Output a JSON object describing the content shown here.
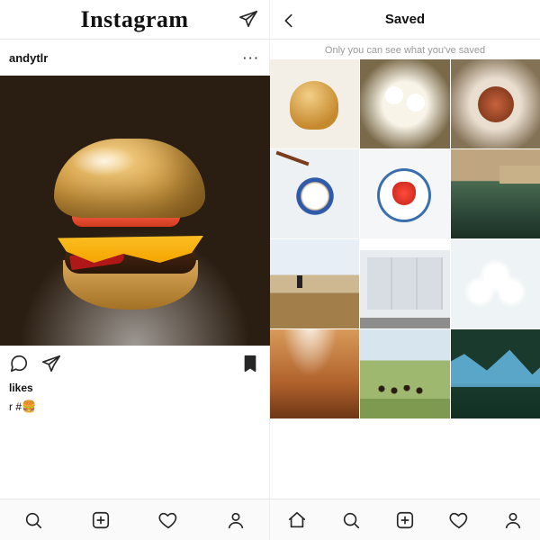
{
  "left": {
    "app_logo_text": "Instagram",
    "username": "andytlr",
    "more_glyph": "···",
    "likes_text": "likes",
    "caption_prefix": "r #",
    "burger_emoji": "🍔"
  },
  "right": {
    "title": "Saved",
    "hint": "Only you can see what you've saved"
  },
  "icons": {
    "direct": "paper-plane-icon",
    "comment": "speech-bubble-icon",
    "share": "paper-plane-icon",
    "bookmark_filled": "bookmark-filled-icon",
    "back": "chevron-left-icon",
    "search": "magnifier-icon",
    "add": "plus-square-icon",
    "heart": "heart-icon",
    "profile": "person-icon",
    "home": "home-icon"
  }
}
